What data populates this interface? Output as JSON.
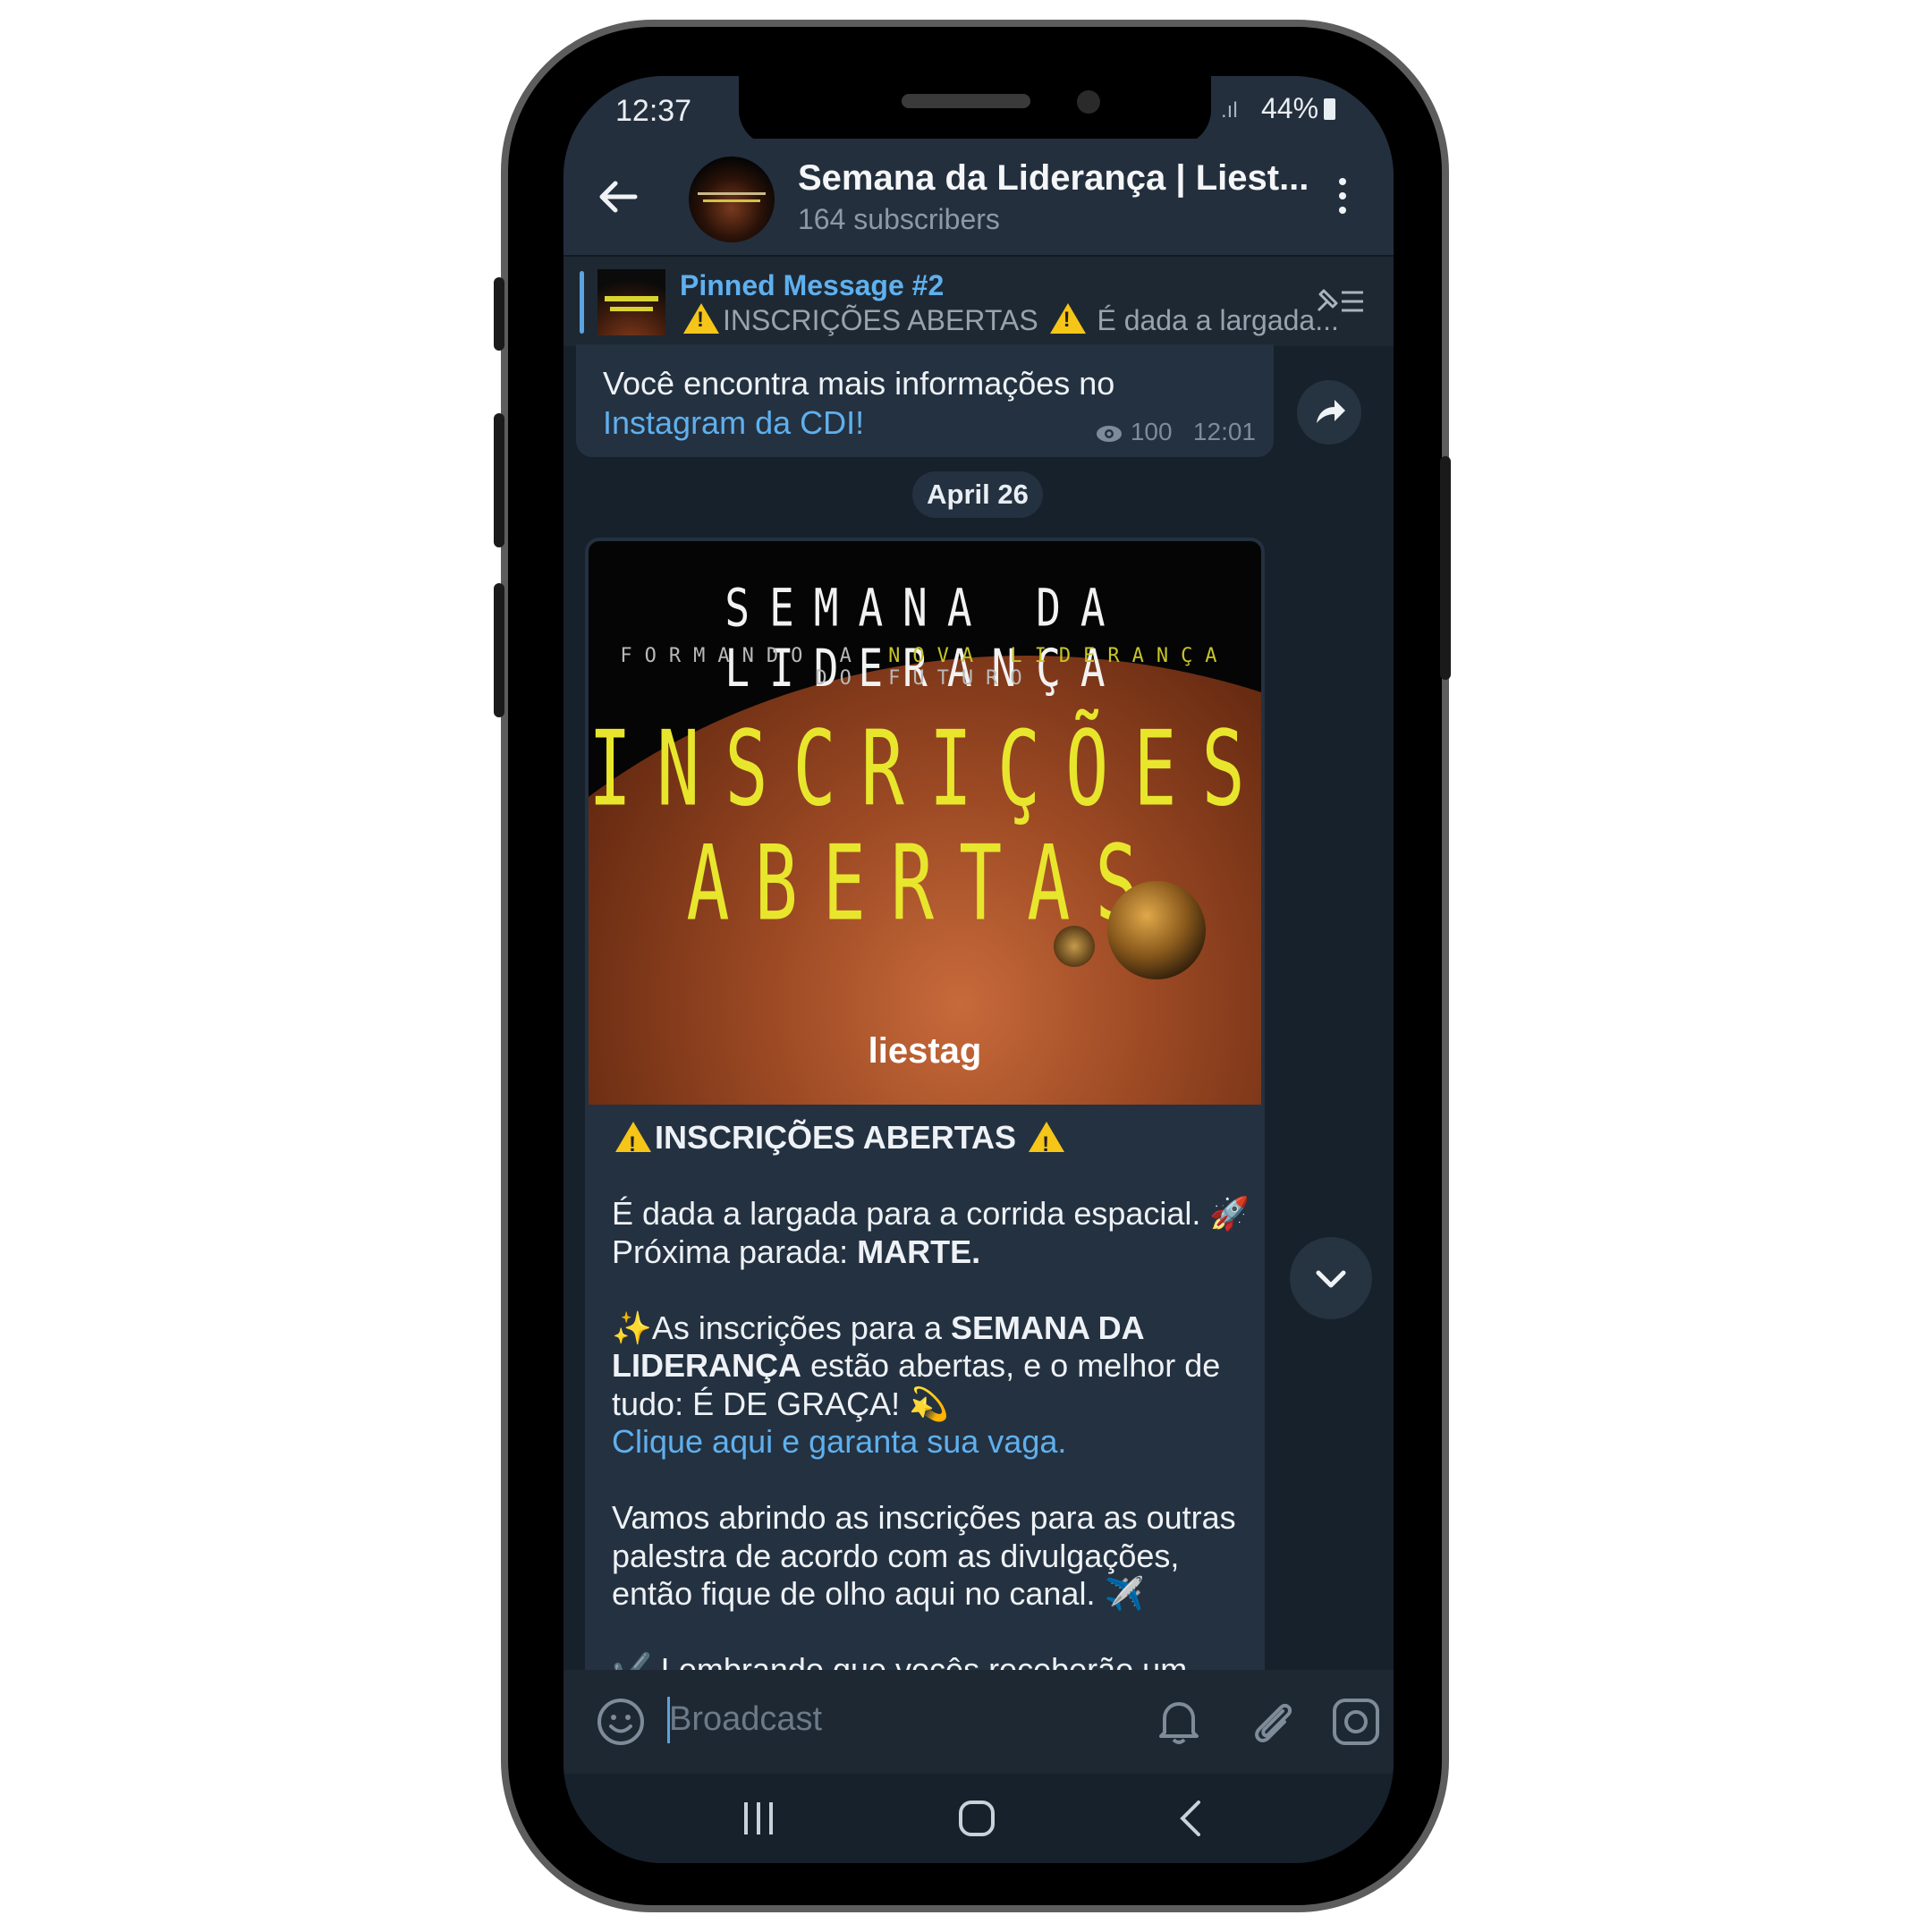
{
  "status_bar": {
    "time": "12:37",
    "signal": ".ıl",
    "battery": "44%"
  },
  "header": {
    "title": "Semana da Liderança | Liest...",
    "subtitle": "164 subscribers"
  },
  "pinned": {
    "title": "Pinned Message #2",
    "text_1": "INSCRIÇÕES ABERTAS",
    "text_2": "É dada a largada..."
  },
  "previous_message": {
    "text": "Você encontra mais informações no",
    "link": "Instagram da CDI!",
    "views": "100",
    "time": "12:01"
  },
  "date_chip": "April 26",
  "poster": {
    "heading": "SEMANA DA LIDERANÇA",
    "sub_1": "FORMANDO A",
    "sub_2": "NOVA LIDERANÇA",
    "sub_3": "DO FUTURO",
    "big_1": "INSCRIÇÕES",
    "big_2": "ABERTAS",
    "logo": "liestag"
  },
  "post": {
    "headline": "INSCRIÇÕES ABERTAS",
    "p1_a": "É dada a largada para a corrida espacial. 🚀",
    "p1_b": "Próxima parada: ",
    "p1_bold": "MARTE.",
    "p2_a": "✨As inscrições para a ",
    "p2_bold": "SEMANA DA LIDERANÇA",
    "p2_b": " estão abertas, e o melhor de tudo: É DE GRAÇA! 💫",
    "p2_link": "Clique aqui e garanta sua vaga.",
    "p3": "Vamos abrindo as inscrições para as outras palestra de acordo com as divulgações, então fique de olho aqui no canal. ✈️",
    "p4_partial": "✔️ Lembrando que vocês receberão um"
  },
  "input": {
    "placeholder": "Broadcast"
  },
  "colors": {
    "background": "#17212b",
    "header": "#242f3d",
    "bubble": "#243140",
    "accent": "#5fb0ee",
    "poster_yellow": "#e8e62c"
  },
  "icons": [
    "back-arrow-icon",
    "more-vert-icon",
    "unpin-list-icon",
    "share-icon",
    "eye-icon",
    "warning-icon",
    "chevron-down-icon",
    "emoji-icon",
    "bell-icon",
    "attach-icon",
    "camera-icon",
    "recents-icon",
    "home-icon",
    "back-nav-icon"
  ]
}
